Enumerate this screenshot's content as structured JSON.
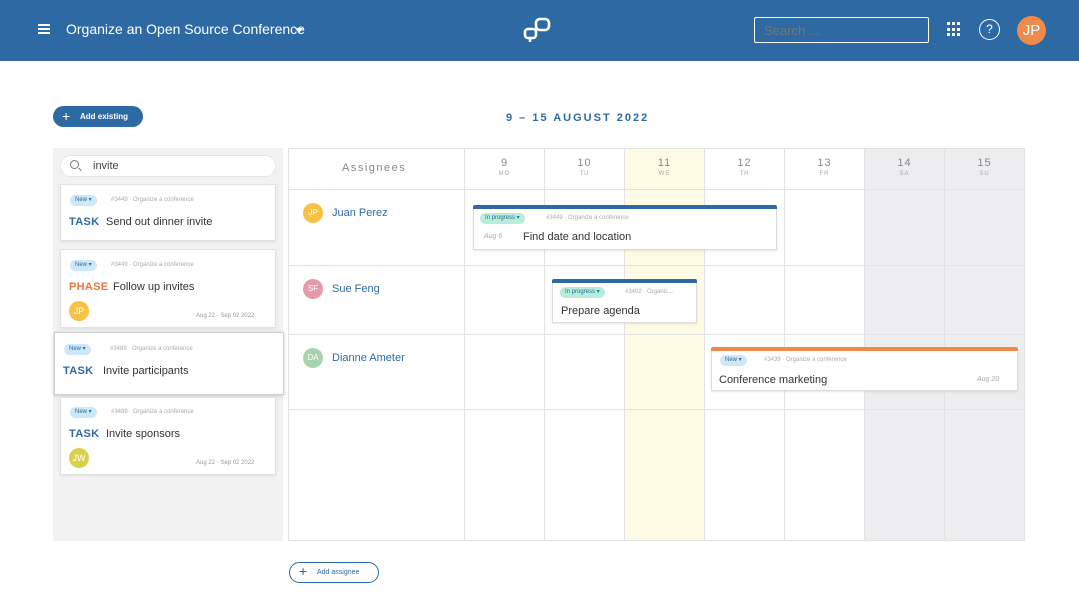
{
  "header": {
    "project_title": "Organize an Open Source Conference",
    "search_placeholder": "Search ...",
    "help_label": "?",
    "user_initials": "JP",
    "icons": [
      "menu-icon",
      "chevron-down-icon",
      "logo-icon",
      "apps-grid-icon",
      "help-icon"
    ]
  },
  "toolbar": {
    "add_existing_label": "Add existing",
    "date_range": "9 – 15 AUGUST 2022"
  },
  "left_panel": {
    "search_value": "invite",
    "cards": [
      {
        "status": "New",
        "meta": "#3449 · Organize a conference",
        "type": "TASK",
        "title": "Send out dinner invite",
        "avatar": "",
        "date": ""
      },
      {
        "status": "New",
        "meta": "#3449 · Organize a conference",
        "type": "PHASE",
        "title": "Follow up invites",
        "avatar": "JP",
        "date": "Aug 22 - Sep 02 2022"
      },
      {
        "status": "New",
        "meta": "#3489 · Organize a conference",
        "type": "TASK",
        "title": "Invite participants",
        "avatar": "",
        "date": ""
      },
      {
        "status": "New",
        "meta": "#3489 · Organize a conference",
        "type": "TASK",
        "title": "Invite sponsors",
        "avatar": "JW",
        "date": "Aug 22 - Sep 02 2022"
      }
    ]
  },
  "calendar": {
    "assignees_header": "Assignees",
    "days": [
      {
        "num": "9",
        "name": "MO"
      },
      {
        "num": "10",
        "name": "TU"
      },
      {
        "num": "11",
        "name": "WE"
      },
      {
        "num": "12",
        "name": "TH"
      },
      {
        "num": "13",
        "name": "FR"
      },
      {
        "num": "14",
        "name": "SA"
      },
      {
        "num": "15",
        "name": "SU"
      }
    ],
    "assignees": [
      {
        "initials": "JP",
        "name": "Juan Perez",
        "color": "#f5c245"
      },
      {
        "initials": "SF",
        "name": "Sue Feng",
        "color": "#e59aa8"
      },
      {
        "initials": "DA",
        "name": "Dianne Ameter",
        "color": "#a9d3b0"
      }
    ],
    "tasks": [
      {
        "status": "In progress",
        "meta": "#3449 · Organize a conference",
        "date": "Aug 6",
        "title": "Find date and location",
        "bar_color": "#2d6aa3"
      },
      {
        "status": "In progress",
        "meta": "#3402 · Organiz...",
        "date": "",
        "title": "Prepare agenda",
        "bar_color": "#2d6aa3"
      },
      {
        "status": "New",
        "meta": "#3439 · Organize a conference",
        "date": "Aug 20",
        "title": "Conference marketing",
        "bar_color": "#f08a4b"
      }
    ]
  },
  "footer": {
    "add_assignee_label": "Add assignee"
  },
  "colors": {
    "primary": "#2d6aa3",
    "accent": "#f08a4b",
    "today": "#fdfbe3",
    "weekend": "#ededf0"
  }
}
